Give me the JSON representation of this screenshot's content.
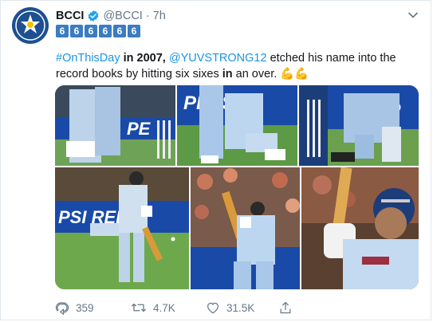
{
  "tweet": {
    "display_name": "BCCI",
    "handle": "@BCCI",
    "separator": "·",
    "time": "7h",
    "badges": [
      "6",
      "6",
      "6",
      "6",
      "6",
      "6"
    ],
    "text": {
      "hashtag": "#OnThisDay",
      "part1": " in 2007, ",
      "mention": "@YUVSTRONG12",
      "part2": " etched his name into the record books by hitting six sixes ",
      "bold_word": "in",
      "part3": " an over. ",
      "emoji": "💪💪"
    }
  },
  "media": {
    "photos": [
      {
        "id": "photo-1",
        "caption_text": "PE"
      },
      {
        "id": "photo-2",
        "caption_text": "PEPSI"
      },
      {
        "id": "photo-3",
        "caption_text": "P"
      },
      {
        "id": "photo-4",
        "caption_text": "PSI  REL"
      },
      {
        "id": "photo-5",
        "caption_text": ""
      },
      {
        "id": "photo-6",
        "caption_text": ""
      }
    ]
  },
  "actions": {
    "reply_count": "359",
    "retweet_count": "4.7K",
    "like_count": "31.5K"
  },
  "icons": {
    "reply": "reply-icon",
    "retweet": "retweet-icon",
    "like": "heart-icon",
    "share": "share-icon",
    "verified": "verified-badge-icon",
    "menu": "chevron-down-icon"
  },
  "colors": {
    "link": "#1b95e0",
    "verified": "#1da1f2",
    "badge": "#3b7cc2",
    "muted": "#657786"
  }
}
